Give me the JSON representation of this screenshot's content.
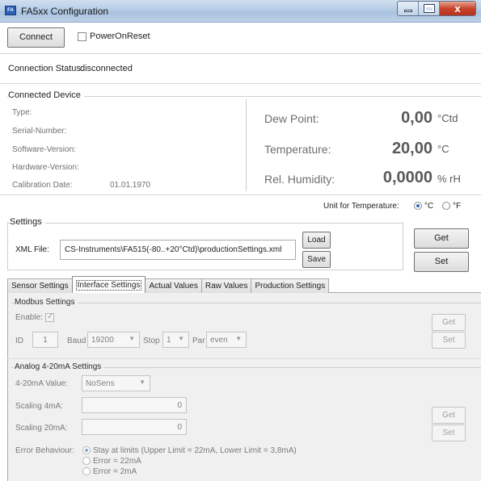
{
  "window": {
    "title": "FA5xx Configuration",
    "app_icon_text": "FA",
    "close_glyph": "x"
  },
  "toolbar": {
    "connect_label": "Connect",
    "power_on_reset_label": "PowerOnReset"
  },
  "connection": {
    "status_label": "Connection Status:",
    "status_value": "disconnected"
  },
  "device": {
    "group_title": "Connected Device",
    "fields": [
      {
        "label": "Type:",
        "value": ""
      },
      {
        "label": "Serial-Number:",
        "value": ""
      },
      {
        "label": "Software-Version:",
        "value": ""
      },
      {
        "label": "Hardware-Version:",
        "value": ""
      },
      {
        "label": "Calibration Date:",
        "value": "01.01.1970"
      }
    ]
  },
  "measurements": [
    {
      "label": "Dew Point:",
      "value": "0,00",
      "unit": "°Ctd"
    },
    {
      "label": "Temperature:",
      "value": "20,00",
      "unit": "°C"
    },
    {
      "label": "Rel. Humidity:",
      "value": "0,0000",
      "unit": "% rH"
    }
  ],
  "temperature_unit": {
    "label": "Unit for Temperature:",
    "options": [
      "°C",
      "°F"
    ],
    "selected": "°C"
  },
  "settings": {
    "group_title": "Settings",
    "xml_label": "XML File:",
    "xml_value": "CS-Instruments\\FA515(-80..+20°Ctd)\\productionSettings.xml",
    "load_label": "Load",
    "save_label": "Save",
    "get_label": "Get",
    "set_label": "Set"
  },
  "tabs": [
    {
      "label": "Sensor Settings",
      "active": false
    },
    {
      "label": "Interface Settings",
      "active": true
    },
    {
      "label": "Actual Values",
      "active": false
    },
    {
      "label": "Raw Values",
      "active": false
    },
    {
      "label": "Production Settings",
      "active": false
    }
  ],
  "modbus": {
    "group_title": "Modbus Settings",
    "enable_label": "Enable:",
    "enabled": true,
    "id_label": "ID",
    "id_value": "1",
    "baud_label": "Baud",
    "baud_value": "19200",
    "stop_label": "Stop",
    "stop_value": "1",
    "par_label": "Par",
    "par_value": "even",
    "get_label": "Get",
    "set_label": "Set"
  },
  "analog": {
    "group_title": "Analog 4-20mA Settings",
    "value_label": "4-20mA Value:",
    "value_selected": "NoSens",
    "scaling4_label": "Scaling 4mA:",
    "scaling4_value": "0",
    "scaling20_label": "Scaling 20mA:",
    "scaling20_value": "0",
    "error_label": "Error Behaviour:",
    "error_options": [
      "Stay at limits (Upper Limit = 22mA, Lower Limit = 3,8mA)",
      "Error = 22mA",
      "Error = 2mA"
    ],
    "error_selected": 0,
    "get_label": "Get",
    "set_label": "Set"
  }
}
